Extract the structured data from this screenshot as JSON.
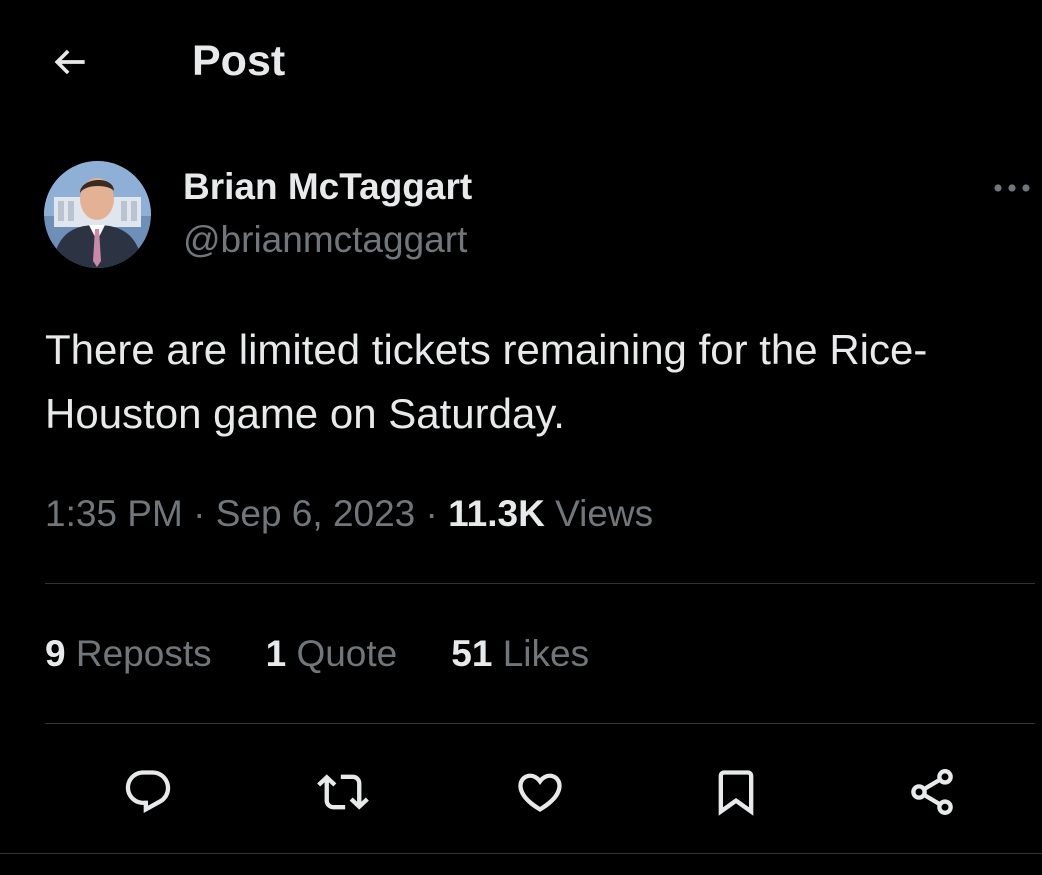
{
  "header": {
    "title": "Post",
    "back_icon": "arrow-left-icon"
  },
  "author": {
    "name": "Brian McTaggart",
    "handle": "@brianmctaggart",
    "avatar_icon": "avatar"
  },
  "post": {
    "text": "There are limited tickets remaining for the Rice-\nHouston game on Saturday.",
    "time": "1:35 PM",
    "date": "Sep 6, 2023",
    "separator": "·",
    "views_count": "11.3K",
    "views_label": "Views"
  },
  "stats": [
    {
      "count": "9",
      "label": "Reposts"
    },
    {
      "count": "1",
      "label": "Quote"
    },
    {
      "count": "51",
      "label": "Likes"
    }
  ],
  "actions": [
    "reply-icon",
    "repost-icon",
    "like-icon",
    "bookmark-icon",
    "share-icon"
  ],
  "colors": {
    "background": "#000000",
    "text_primary": "#e7e9ea",
    "text_secondary": "#71767b",
    "divider": "#2f3336"
  }
}
